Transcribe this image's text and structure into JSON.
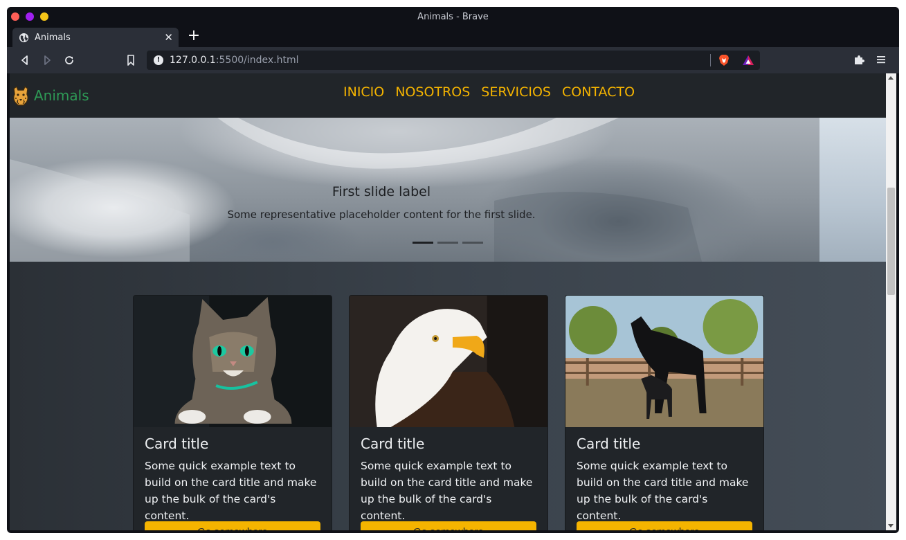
{
  "window": {
    "title": "Animals - Brave"
  },
  "tab": {
    "label": "Animals",
    "close": "✕",
    "new_tab": "+"
  },
  "toolbar": {
    "url_host": "127.0.0.1",
    "url_rest": ":5500/index.html"
  },
  "site": {
    "brand": "Animals",
    "nav": [
      "INICIO",
      "NOSOTROS",
      "SERVICIOS",
      "CONTACTO"
    ],
    "colors": {
      "nav_bg": "#212529",
      "brand": "#2e9a56",
      "nav_link": "#f5b400",
      "button": "#f5b400"
    }
  },
  "carousel": {
    "caption_title": "First slide label",
    "caption_text": "Some representative placeholder content for the first slide.",
    "active_index": 0
  },
  "cards": [
    {
      "image": "cat",
      "title": "Card title",
      "text": "Some quick example text to build on the card title and make up the bulk of the card's content.",
      "button": "Go somewhere"
    },
    {
      "image": "eagle",
      "title": "Card title",
      "text": "Some quick example text to build on the card title and make up the bulk of the card's content.",
      "button": "Go somewhere"
    },
    {
      "image": "horses",
      "title": "Card title",
      "text": "Some quick example text to build on the card title and make up the bulk of the card's content.",
      "button": "Go somewhere"
    }
  ]
}
